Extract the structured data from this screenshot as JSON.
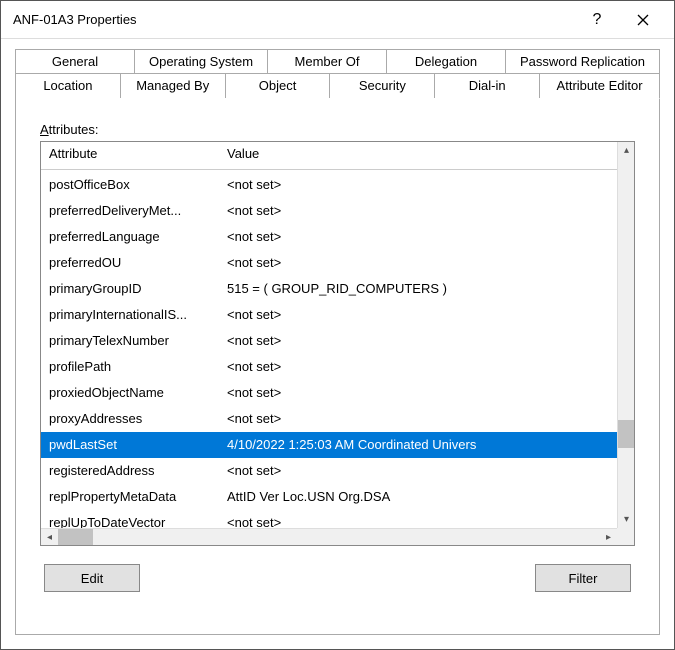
{
  "window": {
    "title": "ANF-01A3 Properties"
  },
  "tabs_row1": [
    {
      "label": "General"
    },
    {
      "label": "Operating System"
    },
    {
      "label": "Member Of"
    },
    {
      "label": "Delegation"
    },
    {
      "label": "Password Replication"
    }
  ],
  "tabs_row2": [
    {
      "label": "Location"
    },
    {
      "label": "Managed By"
    },
    {
      "label": "Object"
    },
    {
      "label": "Security"
    },
    {
      "label": "Dial-in"
    },
    {
      "label": "Attribute Editor",
      "active": true
    }
  ],
  "attributes": {
    "label_prefix": "A",
    "label_rest": "ttributes:",
    "columns": {
      "attr": "Attribute",
      "val": "Value"
    },
    "rows": [
      {
        "attr": "postOfficeBox",
        "val": "<not set>"
      },
      {
        "attr": "preferredDeliveryMet...",
        "val": "<not set>"
      },
      {
        "attr": "preferredLanguage",
        "val": "<not set>"
      },
      {
        "attr": "preferredOU",
        "val": "<not set>"
      },
      {
        "attr": "primaryGroupID",
        "val": "515 = ( GROUP_RID_COMPUTERS )"
      },
      {
        "attr": "primaryInternationalIS...",
        "val": "<not set>"
      },
      {
        "attr": "primaryTelexNumber",
        "val": "<not set>"
      },
      {
        "attr": "profilePath",
        "val": "<not set>"
      },
      {
        "attr": "proxiedObjectName",
        "val": "<not set>"
      },
      {
        "attr": "proxyAddresses",
        "val": "<not set>"
      },
      {
        "attr": "pwdLastSet",
        "val": "4/10/2022 1:25:03 AM Coordinated Univers",
        "selected": true
      },
      {
        "attr": "registeredAddress",
        "val": "<not set>"
      },
      {
        "attr": "replPropertyMetaData",
        "val": " AttID  Ver     Loc.USN               Org.DSA"
      },
      {
        "attr": "replUpToDateVector",
        "val": "<not set>"
      }
    ]
  },
  "buttons": {
    "edit": "Edit",
    "filter": "Filter"
  }
}
